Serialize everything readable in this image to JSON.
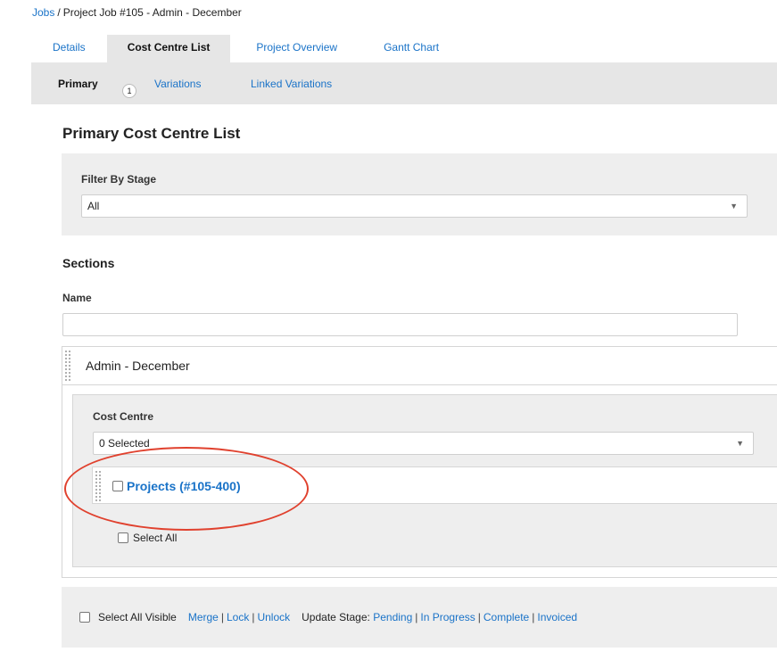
{
  "breadcrumb": {
    "root": "Jobs",
    "separator": "/",
    "current": "Project Job #105 - Admin - December"
  },
  "tabs": [
    {
      "label": "Details",
      "active": false
    },
    {
      "label": "Cost Centre List",
      "active": true
    },
    {
      "label": "Project Overview",
      "active": false
    },
    {
      "label": "Gantt Chart",
      "active": false
    }
  ],
  "subtabs": [
    {
      "label": "Primary",
      "active": true,
      "badge": "1"
    },
    {
      "label": "Variations",
      "active": false
    },
    {
      "label": "Linked Variations",
      "active": false
    }
  ],
  "page_title": "Primary Cost Centre List",
  "filter": {
    "label": "Filter By Stage",
    "value": "All"
  },
  "sections": {
    "title": "Sections",
    "name_label": "Name",
    "name_value": "",
    "section": {
      "title": "Admin - December",
      "cost_centre_label": "Cost Centre",
      "cost_centre_value": "0 Selected",
      "item_link": "Projects (#105-400)",
      "select_all": "Select All"
    }
  },
  "bottom": {
    "select_all_visible": "Select All Visible",
    "merge": "Merge",
    "lock": "Lock",
    "unlock": "Unlock",
    "update_stage_label": "Update Stage:",
    "stages": [
      "Pending",
      "In Progress",
      "Complete",
      "Invoiced"
    ],
    "pipe": "|"
  },
  "icons": {
    "dropdown": "chevron-down-icon",
    "drag": "drag-handle-icon"
  },
  "colors": {
    "link": "#1a73c8",
    "panel": "#eeeeee",
    "tab_active": "#e6e6e6",
    "highlight": "#e0412e"
  }
}
